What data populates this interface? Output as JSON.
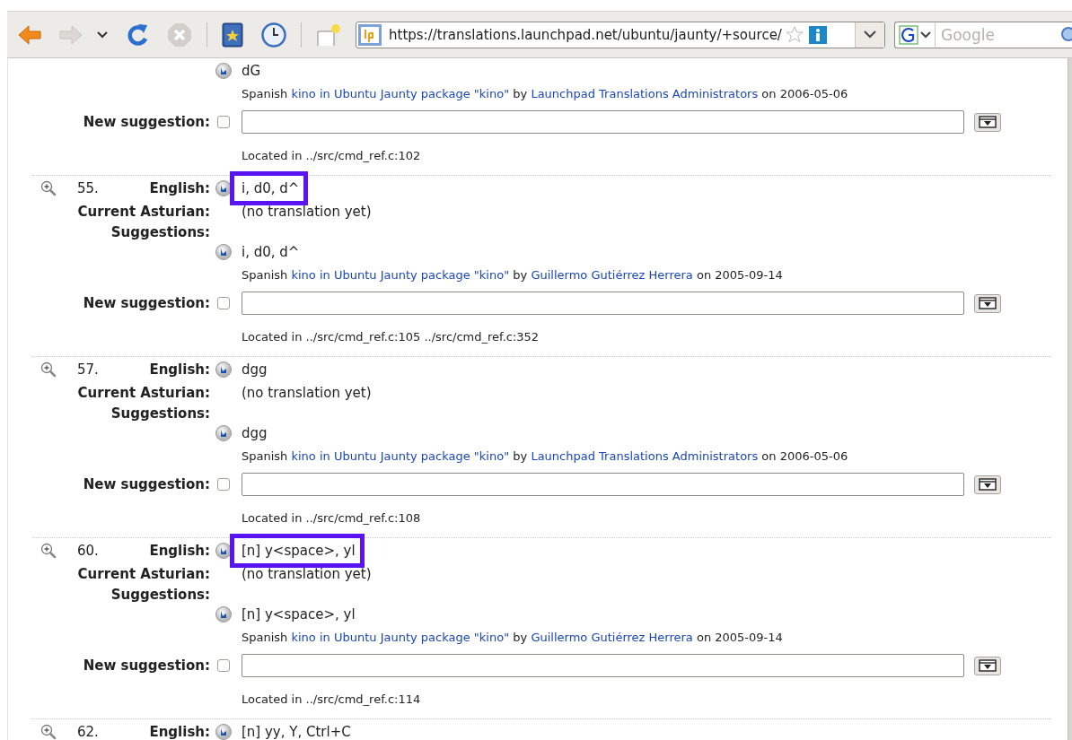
{
  "toolbar": {
    "url": "https://translations.launchpad.net/ubuntu/jaunty/+source/",
    "search": {
      "placeholder": "Google"
    }
  },
  "entries": [
    {
      "suggestions": [
        {
          "text": "dG",
          "language": "Spanish",
          "package": "kino in Ubuntu Jaunty package \"kino\"",
          "by": "by",
          "author": "Launchpad Translations Administrators",
          "date": "on 2006-05-06"
        }
      ],
      "new_suggestion": {
        "label": "New suggestion:",
        "checked": false
      },
      "located": "Located in ../src/cmd_ref.c:102"
    },
    {
      "number": "55.",
      "english_label": "English:",
      "english": "i, d0, d^",
      "highlighted": true,
      "current_label": "Current Asturian:",
      "current": "(no translation yet)",
      "suggestions_label": "Suggestions:",
      "suggestions": [
        {
          "text": "i, d0, d^",
          "language": "Spanish",
          "package": "kino in Ubuntu Jaunty package \"kino\"",
          "by": "by",
          "author": "Guillermo Gutiérrez Herrera",
          "date": "on 2005-09-14"
        }
      ],
      "new_suggestion": {
        "label": "New suggestion:",
        "checked": false
      },
      "located": "Located in ../src/cmd_ref.c:105 ../src/cmd_ref.c:352"
    },
    {
      "number": "57.",
      "english_label": "English:",
      "english": "dgg",
      "highlighted": false,
      "current_label": "Current Asturian:",
      "current": "(no translation yet)",
      "suggestions_label": "Suggestions:",
      "suggestions": [
        {
          "text": "dgg",
          "language": "Spanish",
          "package": "kino in Ubuntu Jaunty package \"kino\"",
          "by": "by",
          "author": "Launchpad Translations Administrators",
          "date": "on 2006-05-06"
        }
      ],
      "new_suggestion": {
        "label": "New suggestion:",
        "checked": false
      },
      "located": "Located in ../src/cmd_ref.c:108"
    },
    {
      "number": "60.",
      "english_label": "English:",
      "english": "[n] y<space>, yl",
      "highlighted": true,
      "current_label": "Current Asturian:",
      "current": "(no translation yet)",
      "suggestions_label": "Suggestions:",
      "suggestions": [
        {
          "text": "[n] y<space>, yl",
          "language": "Spanish",
          "package": "kino in Ubuntu Jaunty package \"kino\"",
          "by": "by",
          "author": "Guillermo Gutiérrez Herrera",
          "date": "on 2005-09-14"
        }
      ],
      "new_suggestion": {
        "label": "New suggestion:",
        "checked": false
      },
      "located": "Located in ../src/cmd_ref.c:114"
    },
    {
      "number": "62.",
      "english_label": "English:",
      "english": "[n] yy, Y, Ctrl+C",
      "highlighted": false
    }
  ]
}
